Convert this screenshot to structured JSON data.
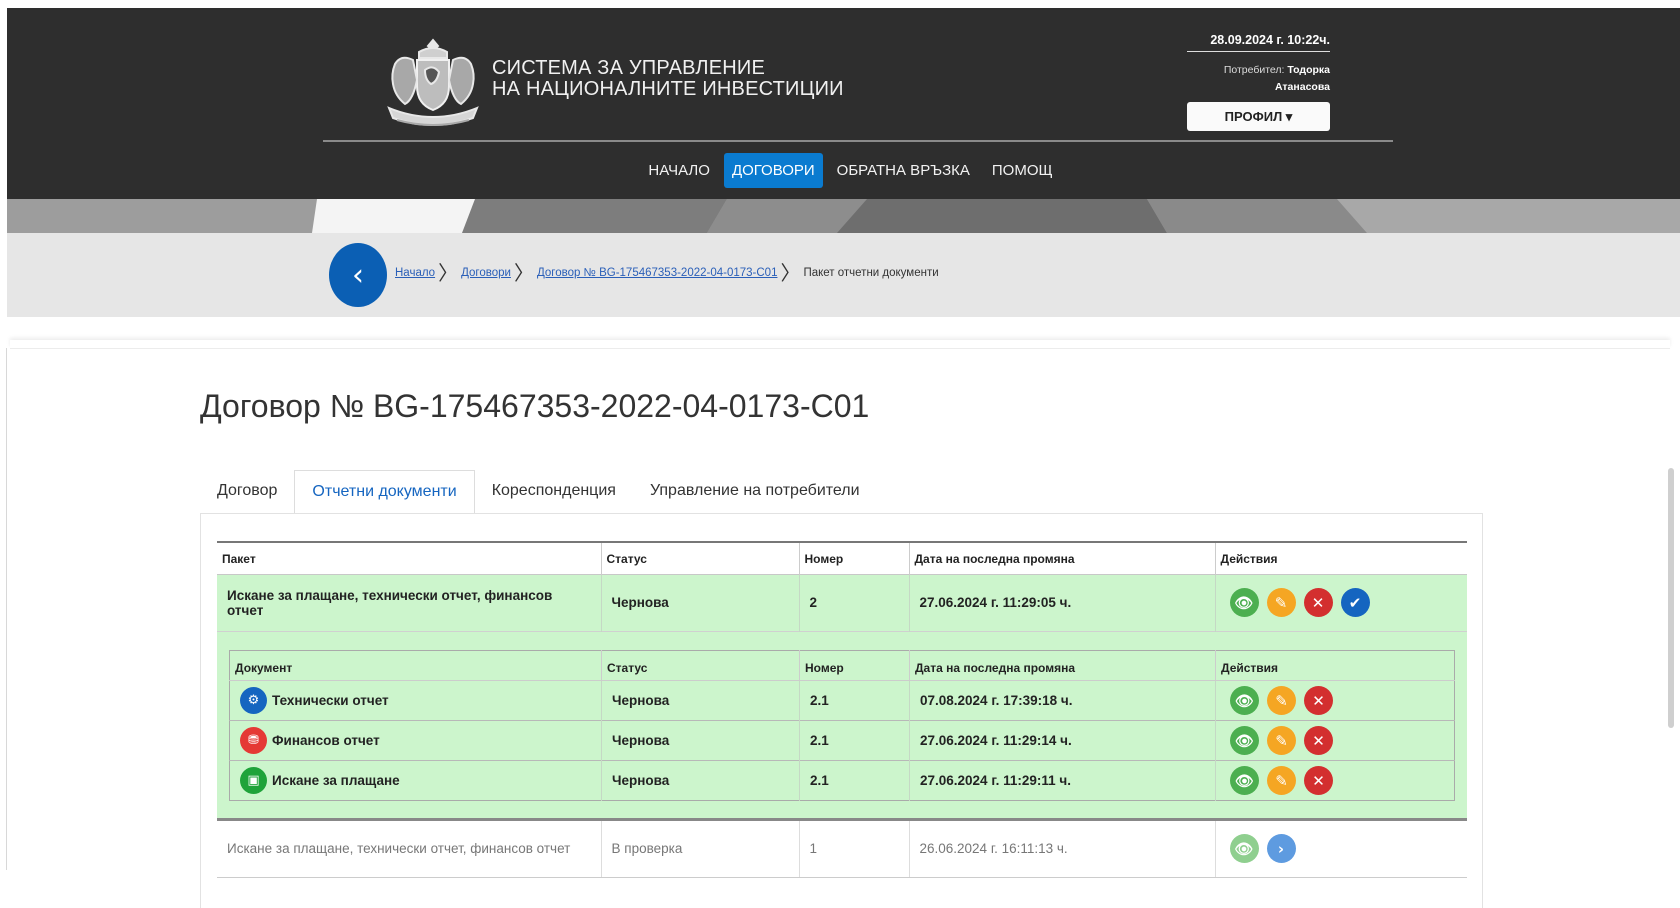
{
  "header": {
    "system_title_line1": "СИСТЕМА ЗА УПРАВЛЕНИЕ",
    "system_title_line2": "НА НАЦИОНАЛНИТЕ ИНВЕСТИЦИИ",
    "datetime": "28.09.2024 г. 10:22ч.",
    "user_label": "Потребител:",
    "user_first_name": "Тодорка",
    "user_last_name": "Атанасова",
    "profile_button": "ПРОФИЛ ▾",
    "nav": [
      {
        "label": "НАЧАЛО",
        "active": false
      },
      {
        "label": "ДОГОВОРИ",
        "active": true
      },
      {
        "label": "ОБРАТНА ВРЪЗКА",
        "active": false
      },
      {
        "label": "ПОМОЩ",
        "active": false
      }
    ]
  },
  "breadcrumb": {
    "back_icon": "‹",
    "items": [
      "Начало",
      "Договори",
      "Договор № BG-175467353-2022-04-0173-C01"
    ],
    "current": "Пакет отчетни документи",
    "separator": "〉"
  },
  "page": {
    "title": "Договор № BG-175467353-2022-04-0173-C01",
    "tabs": [
      {
        "label": "Договор",
        "active": false
      },
      {
        "label": "Отчетни документи",
        "active": true
      },
      {
        "label": "Кореспонденция",
        "active": false
      },
      {
        "label": "Управление на потребители",
        "active": false
      }
    ]
  },
  "packages_table": {
    "headers": [
      "Пакет",
      "Статус",
      "Номер",
      "Дата на последна промяна",
      "Действия"
    ],
    "current_package": {
      "name": "Искане за плащане, технически отчет, финансов отчет",
      "status": "Чернова",
      "number": "2",
      "date": "27.06.2024 г. 11:29:05 ч.",
      "actions": [
        "view",
        "edit",
        "delete",
        "submit"
      ]
    },
    "documents": {
      "headers": [
        "Документ",
        "Статус",
        "Номер",
        "Дата на последна промяна",
        "Действия"
      ],
      "rows": [
        {
          "name": "Технически отчет",
          "icon": "gear-doc-icon",
          "icon_color": "#1565c0",
          "status": "Чернова",
          "number": "2.1",
          "date": "07.08.2024 г. 17:39:18 ч."
        },
        {
          "name": "Финансов отчет",
          "icon": "coins-icon",
          "icon_color": "#e53935",
          "status": "Чернова",
          "number": "2.1",
          "date": "27.06.2024 г. 11:29:14 ч."
        },
        {
          "name": "Искане за плащане",
          "icon": "wallet-icon",
          "icon_color": "#1fa33a",
          "status": "Чернова",
          "number": "2.1",
          "date": "27.06.2024 г. 11:29:11 ч."
        }
      ]
    },
    "previous_package": {
      "name": "Искане за плащане, технически отчет, финансов отчет",
      "status": "В проверка",
      "number": "1",
      "date": "26.06.2024 г. 16:11:13 ч.",
      "actions": [
        "view",
        "next"
      ]
    }
  },
  "icons": {
    "view": "👁",
    "edit": "✎",
    "delete": "✕",
    "submit": "✔",
    "next": "›"
  },
  "colors": {
    "header_bg": "#2e2e2e",
    "accent": "#0a7bd0",
    "row_highlight": "#ccf5cc"
  }
}
